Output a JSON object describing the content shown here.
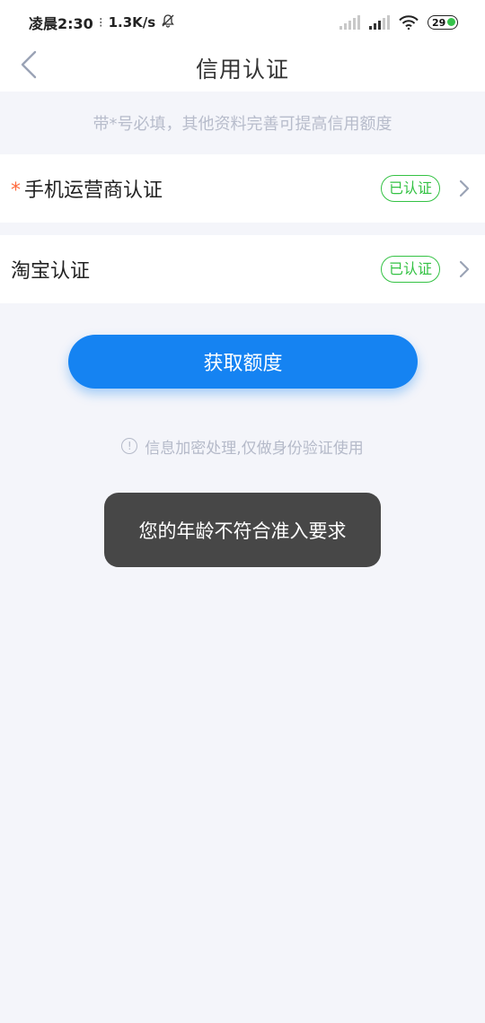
{
  "status_bar": {
    "time": "凌晨2:30",
    "speed": "1.3K/s",
    "battery": "29"
  },
  "nav": {
    "title": "信用认证"
  },
  "hint": "带*号必填，其他资料完善可提高信用额度",
  "rows": [
    {
      "label": "手机运营商认证",
      "required": "*",
      "status": "已认证"
    },
    {
      "label": "淘宝认证",
      "status": "已认证"
    }
  ],
  "primary_button": "获取额度",
  "privacy_note": "信息加密处理,仅做身份验证使用",
  "toast": "您的年龄不符合准入要求",
  "colors": {
    "accent": "#1583f2",
    "verified": "#34c244",
    "required": "#ff6a3d",
    "background": "#f4f5fa"
  }
}
